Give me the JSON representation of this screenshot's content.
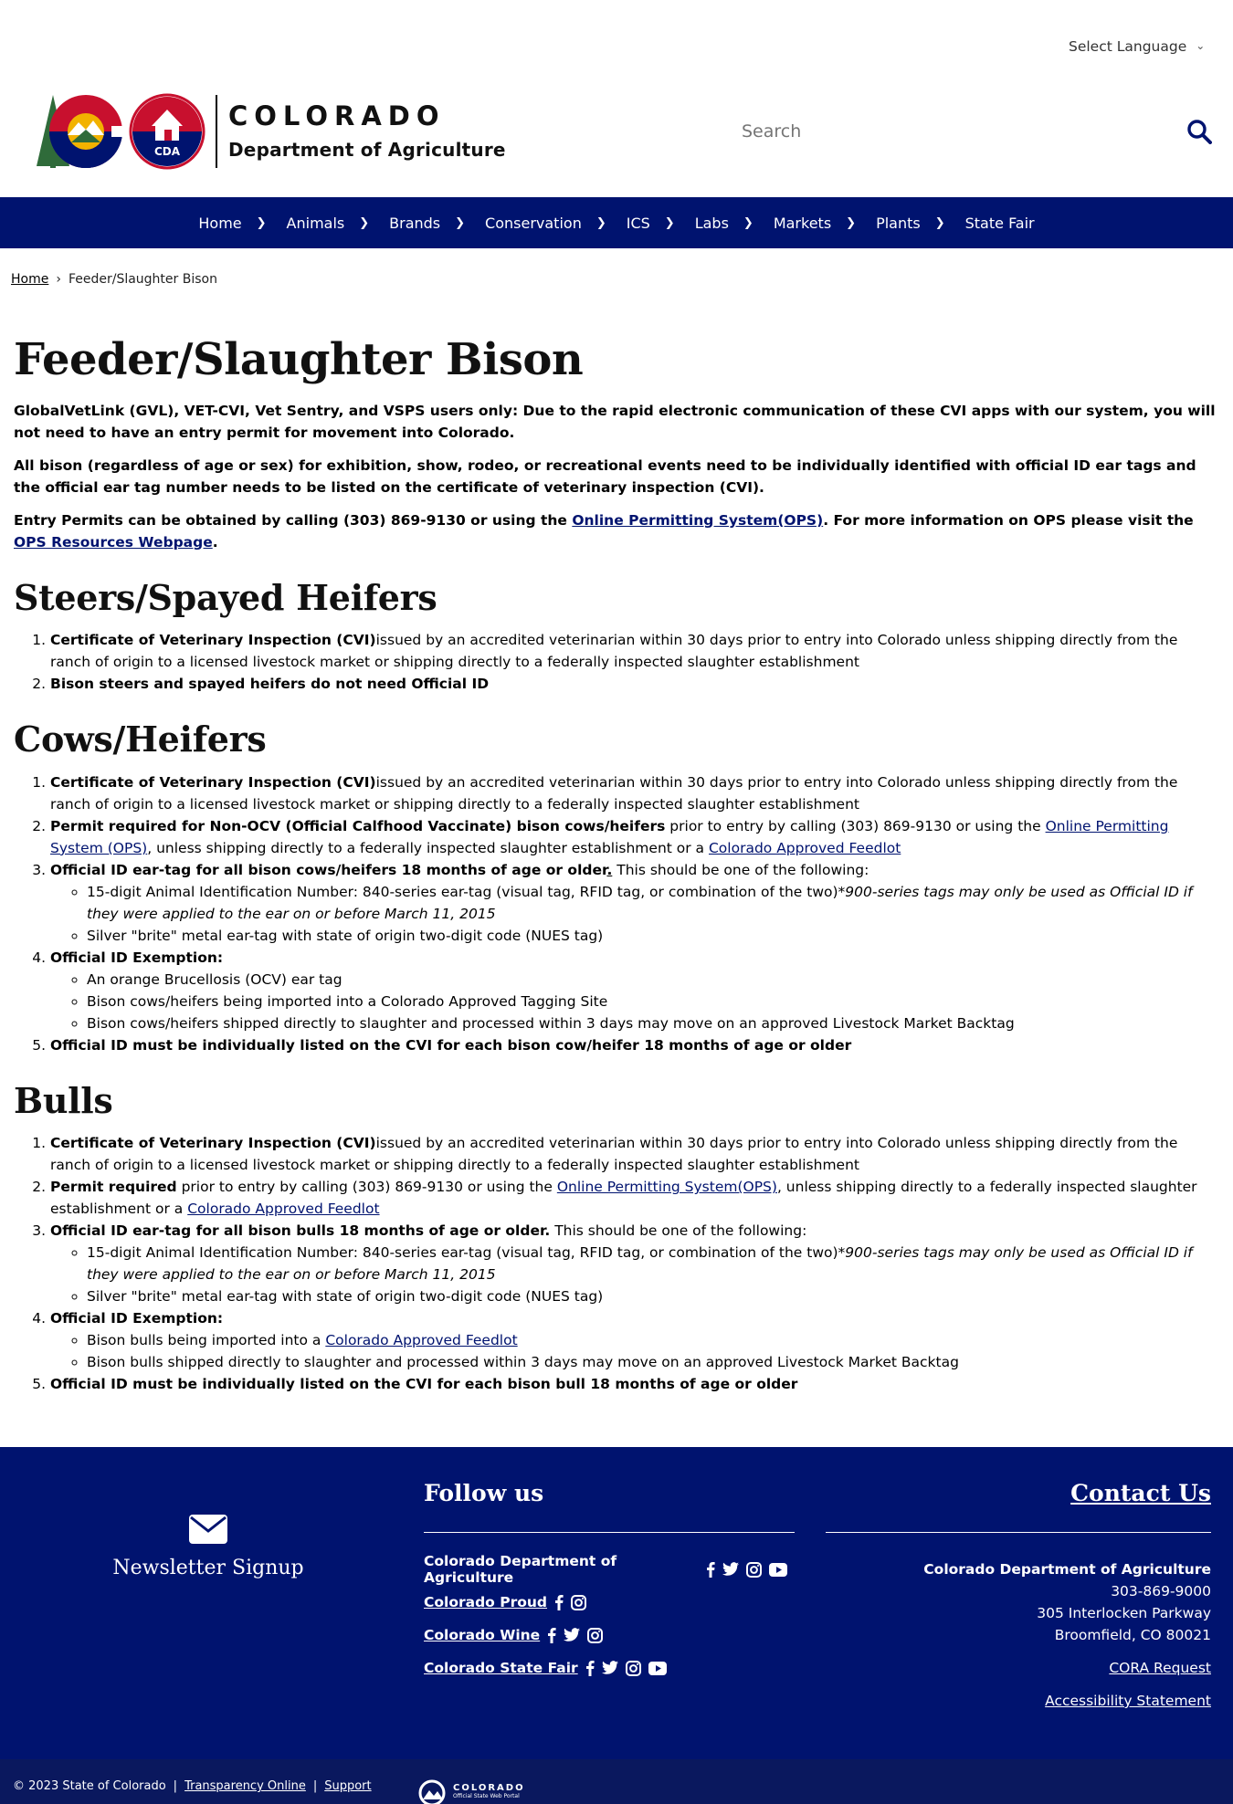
{
  "header": {
    "language_select": "Select Language",
    "brand_title": "COLORADO",
    "brand_subtitle": "Department of Agriculture",
    "logo_badge": "CDA",
    "search_placeholder": "Search"
  },
  "nav": {
    "items": [
      "Home",
      "Animals",
      "Brands",
      "Conservation",
      "ICS",
      "Labs",
      "Markets",
      "Plants",
      "State Fair"
    ]
  },
  "breadcrumb": {
    "home": "Home",
    "separator": "›",
    "current": "Feeder/Slaughter Bison"
  },
  "main": {
    "title": "Feeder/Slaughter Bison",
    "intro1": "GlobalVetLink (GVL), VET-CVI, Vet Sentry, and VSPS users only: Due to the rapid electronic communication of these CVI apps with our system, you will not need to have an entry permit for movement into Colorado.",
    "intro2": "All bison (regardless of age or sex) for exhibition, show, rodeo, or recreational events need to be individually identified with official ID ear tags and the official ear tag number needs to be listed on the certificate of veterinary inspection (CVI).",
    "intro3_a": "Entry Permits can be obtained by calling (303) 869-9130 or using the ",
    "intro3_link1": "Online Permitting System(OPS)",
    "intro3_b": ". For more information on OPS please visit the ",
    "intro3_link2": "OPS Resources Webpage",
    "intro3_c": "."
  },
  "steers": {
    "heading": "Steers/Spayed Heifers",
    "item1_bold": "Certificate of Veterinary Inspection (CVI)",
    "item1_text": "issued by an accredited veterinarian within 30 days prior to entry into Colorado unless shipping directly from the ranch of origin to a licensed livestock market or shipping directly to a federally inspected slaughter establishment",
    "item2_bold": "Bison steers and spayed heifers do not need Official ID"
  },
  "cows": {
    "heading": "Cows/Heifers",
    "item1_bold": "Certificate of Veterinary Inspection (CVI)",
    "item1_text": "issued by an accredited veterinarian within 30 days prior to entry into Colorado unless shipping directly from the ranch of origin to a licensed livestock market or shipping directly to a federally inspected slaughter establishment",
    "item2_bold": "Permit required for Non-OCV (Official Calfhood Vaccinate) bison cows/heifers",
    "item2_text": " prior to entry by calling (303) 869-9130 or using the ",
    "item2_link1": "Online Permitting System (OPS)",
    "item2_text2": ", unless shipping directly to a federally inspected slaughter establishment or a ",
    "item2_link2": "Colorado Approved Feedlot",
    "item3_bold": "Official ID ear-tag for all bison cows/heifers 18 months of age or older",
    "item3_punct": ".",
    "item3_text": " This should be one of the following:",
    "item3_sub1_text": "15-digit Animal Identification Number: 840-series ear-tag (visual tag, RFID tag, or combination of the two)",
    "item3_sub1_italic": "*900-series tags may only be used as Official ID if they were applied to the ear on or before March 11, 2015",
    "item3_sub2": "Silver \"brite\" metal ear-tag with state of origin two-digit code (NUES tag)",
    "item4_bold": "Official ID Exemption:",
    "item4_sub1": "An orange Brucellosis (OCV) ear tag",
    "item4_sub2": "Bison cows/heifers being imported into a Colorado Approved Tagging Site",
    "item4_sub3": "Bison cows/heifers shipped directly to slaughter and processed within 3 days may move on an approved Livestock Market Backtag",
    "item5_bold": "Official ID must be individually listed on the CVI for each bison cow/heifer 18 months of age or older"
  },
  "bulls": {
    "heading": "Bulls",
    "item1_bold": "Certificate of Veterinary Inspection (CVI)",
    "item1_text": "issued by an accredited veterinarian within 30 days prior to entry into Colorado unless shipping directly from the ranch of origin to a licensed livestock market or shipping directly to a federally inspected slaughter establishment",
    "item2_bold": "Permit required",
    "item2_text": " prior to entry by calling (303) 869-9130 or using the ",
    "item2_link1": "Online Permitting System(OPS)",
    "item2_text2": ", unless shipping directly to a federally inspected slaughter establishment or a ",
    "item2_link2": "Colorado Approved Feedlot",
    "item3_bold": "Official ID ear-tag for all bison bulls 18 months of age or older.",
    "item3_text": " This should be one of the following:",
    "item3_sub1_text": "15-digit Animal Identification Number: 840-series ear-tag (visual tag, RFID tag, or combination of the two)",
    "item3_sub1_italic": "*900-series tags may only be used as Official ID if they were applied to the ear on or before March 11, 2015",
    "item3_sub2": "Silver \"brite\" metal ear-tag with state of origin two-digit code (NUES tag)",
    "item4_bold": "Official ID Exemption:",
    "item4_sub1_text": "Bison bulls being imported into a ",
    "item4_sub1_link": "Colorado Approved Feedlot",
    "item4_sub2": "Bison bulls shipped directly to slaughter and processed within 3 days may move on an approved Livestock Market Backtag",
    "item5_bold": "Official ID must be individually listed on the CVI for each bison bull 18 months of age or older"
  },
  "footer": {
    "newsletter": "Newsletter Signup",
    "follow_title": "Follow us",
    "social": [
      {
        "name": "Colorado Department of Agriculture",
        "icons": [
          "facebook-icon",
          "twitter-icon",
          "instagram-icon",
          "youtube-icon"
        ]
      },
      {
        "name": "Colorado Proud",
        "icons": [
          "facebook-icon",
          "instagram-icon"
        ]
      },
      {
        "name": "Colorado Wine",
        "icons": [
          "facebook-icon",
          "twitter-icon",
          "instagram-icon"
        ]
      },
      {
        "name": "Colorado State Fair",
        "icons": [
          "facebook-icon",
          "twitter-icon",
          "instagram-icon",
          "youtube-icon"
        ]
      }
    ],
    "contact_title": "Contact Us",
    "org": "Colorado Department of Agriculture",
    "phone": "303-869-9000",
    "address1": "305 Interlocken Parkway",
    "address2": "Broomfield, CO 80021",
    "cora": "CORA Request",
    "accessibility": "Accessibility Statement"
  },
  "bottom": {
    "copyright": "© 2023 State of Colorado",
    "sep": "|",
    "transparency": "Transparency Online",
    "support": "Support",
    "portal_title": "COLORADO",
    "portal_sub": "Official State Web Portal"
  },
  "colors": {
    "navy": "#00136f",
    "red": "#c8102e",
    "gold": "#f2b200",
    "green": "#2f6b3a"
  }
}
